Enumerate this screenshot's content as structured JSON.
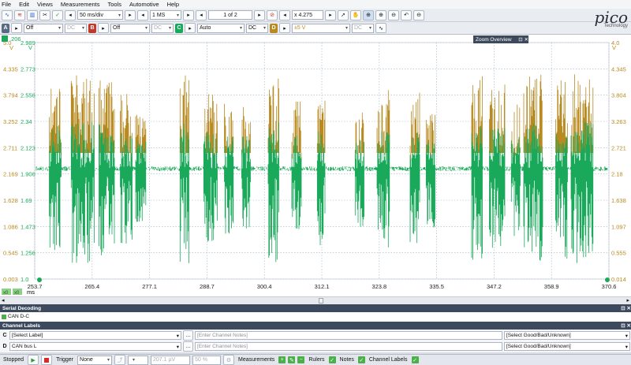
{
  "menu": [
    "File",
    "Edit",
    "Views",
    "Measurements",
    "Tools",
    "Automotive",
    "Help"
  ],
  "toolbar": {
    "timebase": "50 ms/div",
    "samples": "1 MS",
    "page": "1 of 2",
    "zoom": "x 4.275"
  },
  "channels_bar": {
    "a_letter": "A",
    "a_range": "Off",
    "a_coupling": "DC",
    "b_letter": "B",
    "b_range": "Off",
    "b_coupling": "DC",
    "c_letter": "C",
    "c_range": "Auto",
    "c_coupling": "DC",
    "d_letter": "D",
    "d_range": "±5 V",
    "d_coupling": "DC"
  },
  "logo": {
    "word": "pico",
    "sub": "Technology"
  },
  "scope": {
    "top_left_label": ".206",
    "zoom_overview_title": "Zoom Overview",
    "left_unit_c": "V",
    "left_unit_d": "V",
    "right_unit": "V",
    "left_axis_d": [
      "5.0",
      "4.335",
      "3.794",
      "3.252",
      "2.711",
      "2.169",
      "1.628",
      "1.086",
      "0.545",
      "0.003"
    ],
    "left_axis_c": [
      "2.989",
      "2.773",
      "2.556",
      "2.34",
      "2.123",
      "1.906",
      "1.69",
      "1.473",
      "1.256",
      "1.0"
    ],
    "right_axis": [
      "4.0",
      "4.345",
      "3.804",
      "3.263",
      "2.721",
      "2.18",
      "1.638",
      "1.097",
      "0.555",
      "0.014"
    ],
    "x_ticks": [
      "253.7",
      "265.4",
      "277.1",
      "288.7",
      "300.4",
      "312.1",
      "323.8",
      "335.5",
      "347.2",
      "358.9",
      "370.6"
    ],
    "x_unit": "ms",
    "bottom_left_markers": [
      "x0",
      "x0"
    ],
    "colors": {
      "channel_c": "#1aa85a",
      "channel_d": "#b88a22",
      "grid": "#9fb3c8"
    }
  },
  "serial_decoding": {
    "title": "Serial Decoding",
    "tab": "CAN D-C"
  },
  "channel_labels": {
    "title": "Channel Labels",
    "rows": [
      {
        "ch": "C",
        "label": "[Select Label]",
        "notes": "[Enter Channel Notes]",
        "grade": "[Select Good/Bad/Unknown]"
      },
      {
        "ch": "D",
        "label": "CAN bus L",
        "notes": "[Enter Channel Notes]",
        "grade": "[Select Good/Bad/Unknown]"
      }
    ]
  },
  "status": {
    "state": "Stopped",
    "trigger_label": "Trigger",
    "trigger_mode": "None",
    "level": "207.1 µV",
    "percent": "50 %",
    "measurements": "Measurements",
    "rulers": "Rulers",
    "notes": "Notes",
    "channel_labels": "Channel Labels"
  }
}
